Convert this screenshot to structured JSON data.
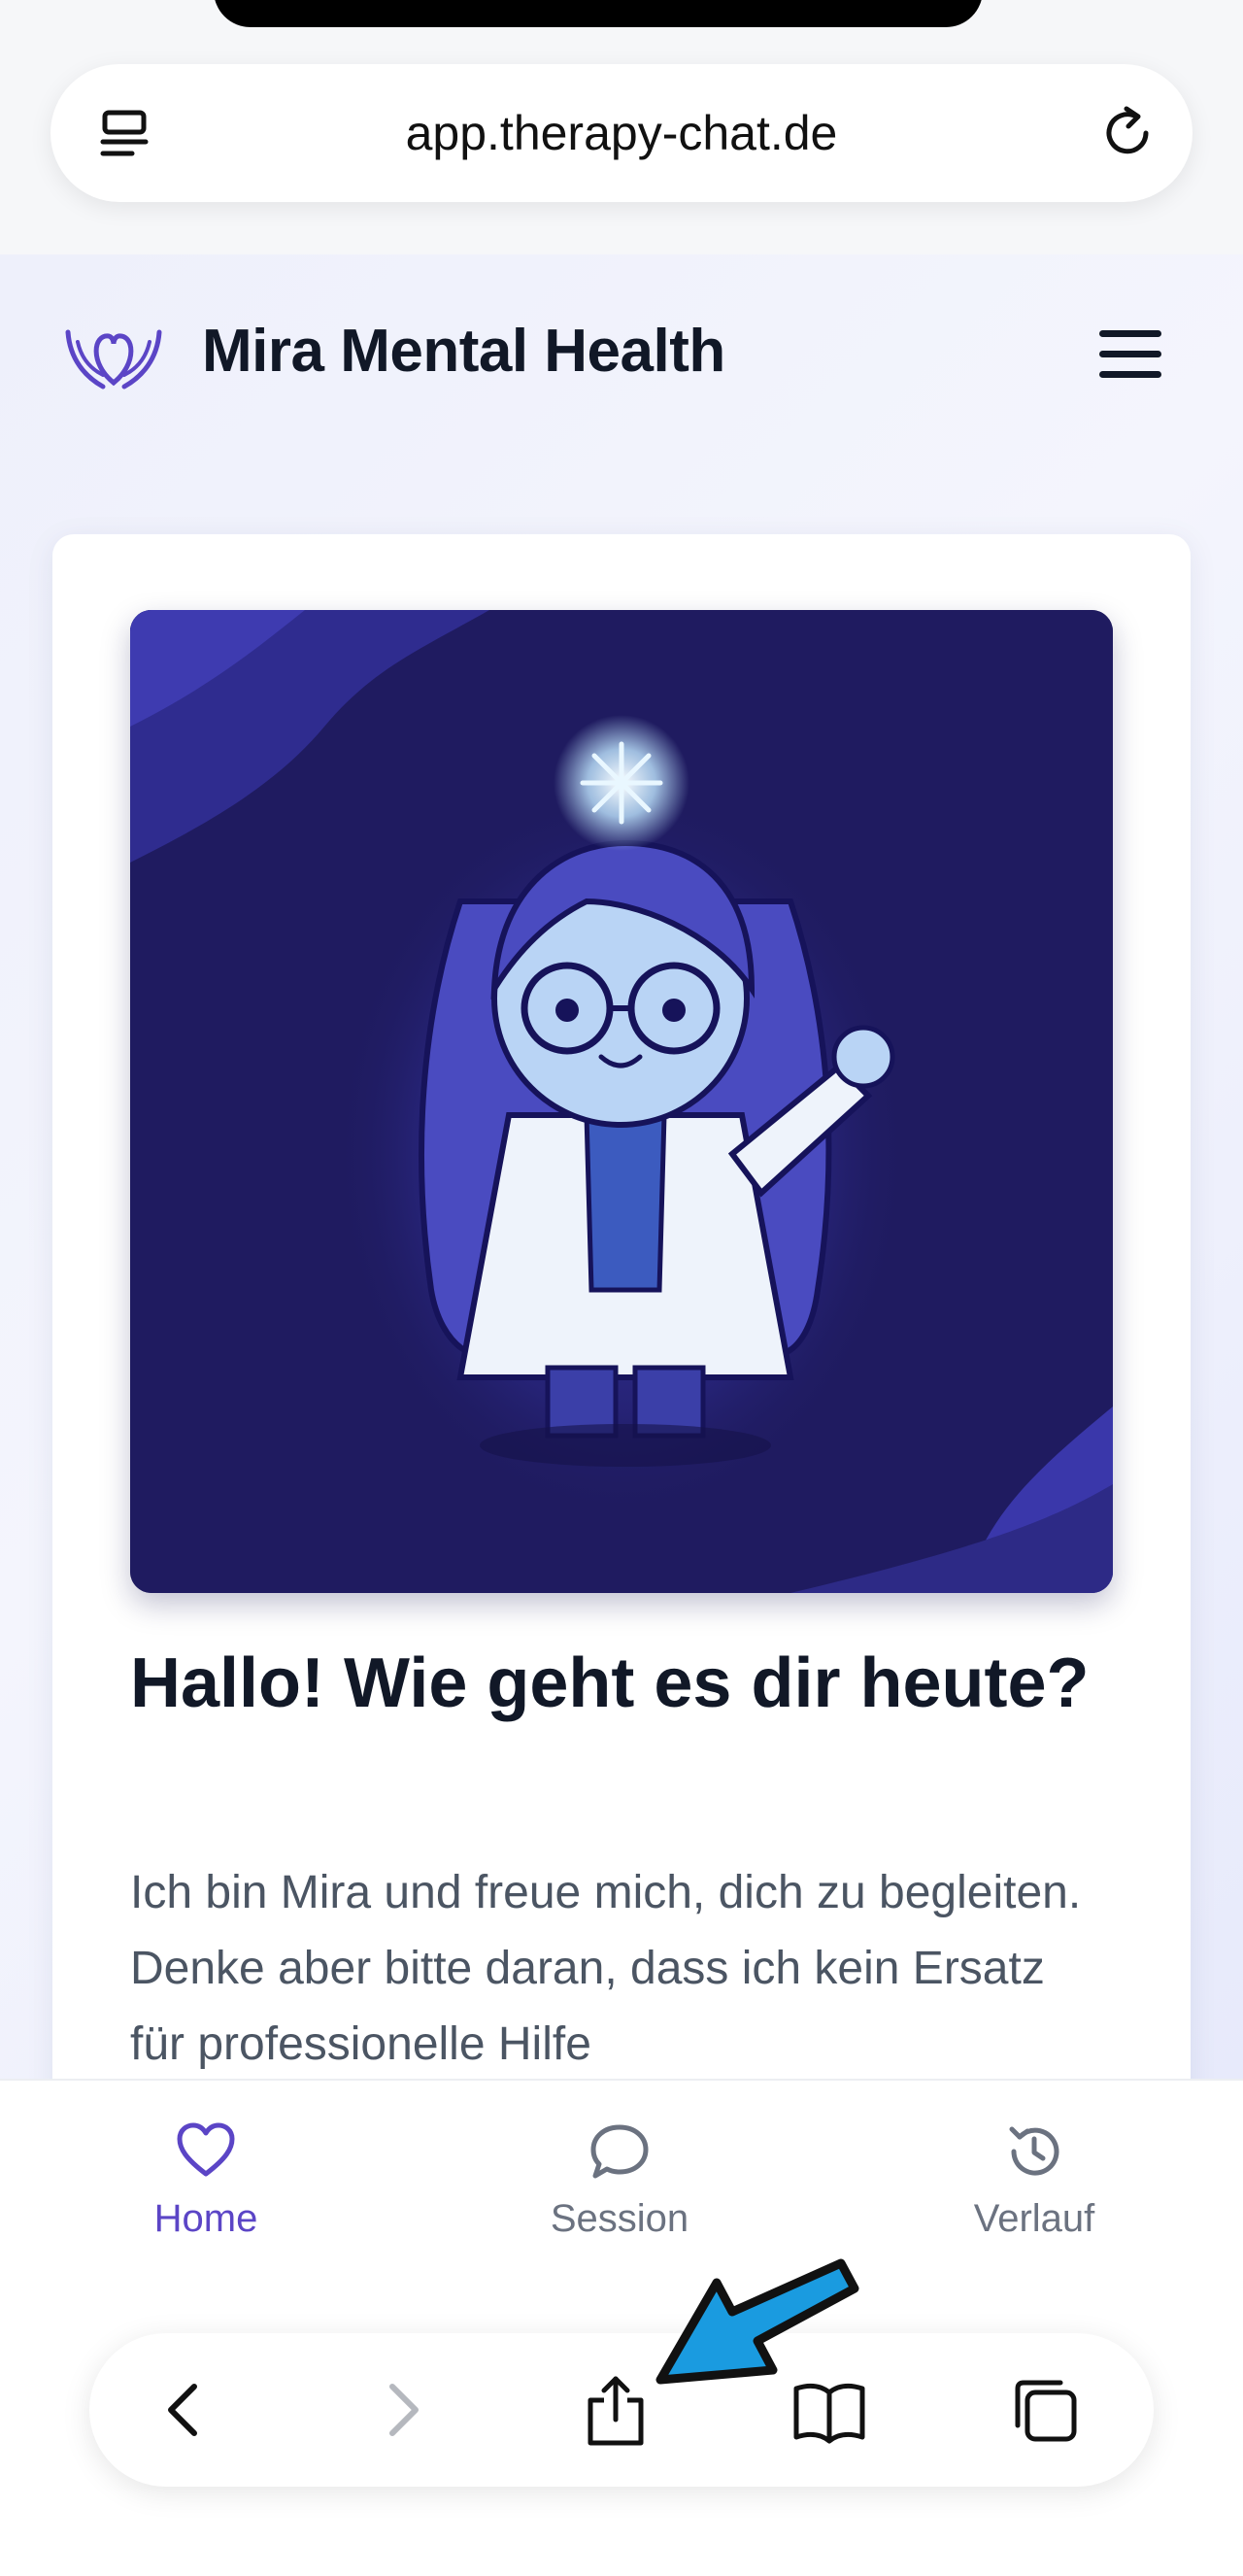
{
  "browser": {
    "url": "app.therapy-chat.de",
    "reader_icon": "reader-mode-icon",
    "reload_icon": "reload-icon"
  },
  "site": {
    "brand": "Mira Mental Health",
    "logo_icon": "heart-hands-icon",
    "menu_icon": "hamburger-menu-icon"
  },
  "card": {
    "headline": "Hallo! Wie geht es dir heute?",
    "intro": "Ich bin Mira und freue mich, dich zu begleiten. Denke aber bitte daran, dass ich kein Ersatz für professionelle Hilfe"
  },
  "app_nav": {
    "items": [
      {
        "label": "Home",
        "icon": "heart-icon",
        "active": true
      },
      {
        "label": "Session",
        "icon": "chat-bubble-icon",
        "active": false
      },
      {
        "label": "Verlauf",
        "icon": "history-icon",
        "active": false
      }
    ],
    "active_color": "#5b45c6",
    "inactive_color": "#6b7280"
  },
  "toolbar": {
    "buttons": [
      "back-icon",
      "forward-icon",
      "share-icon",
      "bookmarks-icon",
      "tabs-icon"
    ]
  },
  "colors": {
    "accent": "#5b45c6",
    "hero_bg": "#1e1a5e",
    "annotation_arrow": "#1a9be0"
  }
}
